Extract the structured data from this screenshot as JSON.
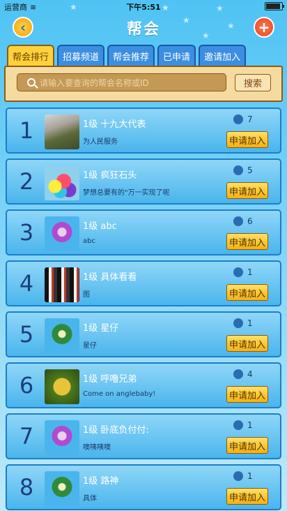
{
  "status": {
    "carrier": "运营商",
    "time": "下午5:51"
  },
  "header": {
    "title": "帮会"
  },
  "tabs": [
    "帮会排行",
    "招募频道",
    "帮会推荐",
    "已申请",
    "邀请加入"
  ],
  "search": {
    "placeholder": "请输入要查询的帮会名称或ID",
    "button": "搜索"
  },
  "join_label": "申请加入",
  "guilds": [
    {
      "rank": "1",
      "name": "1级  十九大代表",
      "desc": "为人民服务",
      "members": "7",
      "avatar": "photo-grass"
    },
    {
      "rank": "2",
      "name": "1级  疯狂石头",
      "desc": "梦想总要有的\"万一实现了呢",
      "members": "5",
      "avatar": "balloons"
    },
    {
      "rank": "3",
      "name": "1级  abc",
      "desc": "abc",
      "members": "6",
      "avatar": "banner-purple"
    },
    {
      "rank": "4",
      "name": "1级  具体看看",
      "desc": "图",
      "members": "1",
      "avatar": "photo-dark"
    },
    {
      "rank": "5",
      "name": "1级  星仔",
      "desc": "星仔",
      "members": "1",
      "avatar": "banner-green"
    },
    {
      "rank": "6",
      "name": "1级  呼噜兄弟",
      "desc": "Come on anglebaby!",
      "members": "4",
      "avatar": "photo-fruit"
    },
    {
      "rank": "7",
      "name": "1级  卧底负付付:",
      "desc": "噢咦咦噢",
      "members": "1",
      "avatar": "banner-purple"
    },
    {
      "rank": "8",
      "name": "1级  路神",
      "desc": "具体",
      "members": "1",
      "avatar": "banner-green"
    }
  ]
}
